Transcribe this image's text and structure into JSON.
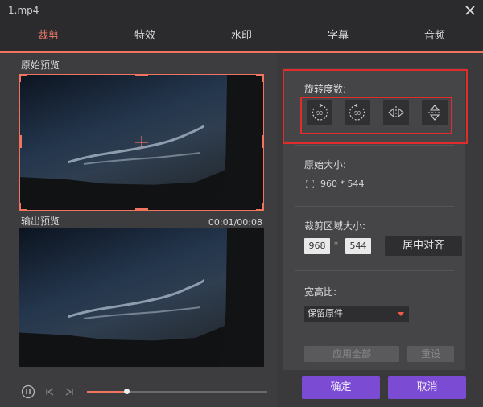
{
  "window": {
    "title": "1.mp4"
  },
  "tabs": [
    {
      "label": "裁剪",
      "active": true
    },
    {
      "label": "特效",
      "active": false
    },
    {
      "label": "水印",
      "active": false
    },
    {
      "label": "字幕",
      "active": false
    },
    {
      "label": "音频",
      "active": false
    }
  ],
  "left": {
    "original_preview_label": "原始预览",
    "output_preview_label": "输出预览",
    "time": "00:01/00:08"
  },
  "right": {
    "rotation": {
      "label": "旋转度数:",
      "buttons": [
        "rotate-left-90",
        "rotate-right-90",
        "flip-horizontal",
        "flip-vertical"
      ],
      "badge_left": "90",
      "badge_right": "90"
    },
    "original_size": {
      "label": "原始大小:",
      "value": "960 * 544"
    },
    "crop_area": {
      "label": "裁剪区域大小:",
      "width": "968",
      "height": "544",
      "center_button": "居中对齐",
      "times": "*"
    },
    "aspect": {
      "label": "宽高比:",
      "selected": "保留原件"
    },
    "apply_all": "应用全部",
    "reset": "重设"
  },
  "footer": {
    "ok": "确定",
    "cancel": "取消"
  },
  "colors": {
    "accent": "#f0745f",
    "purple": "#7c4bd4",
    "highlight_red": "#e22c2c"
  }
}
